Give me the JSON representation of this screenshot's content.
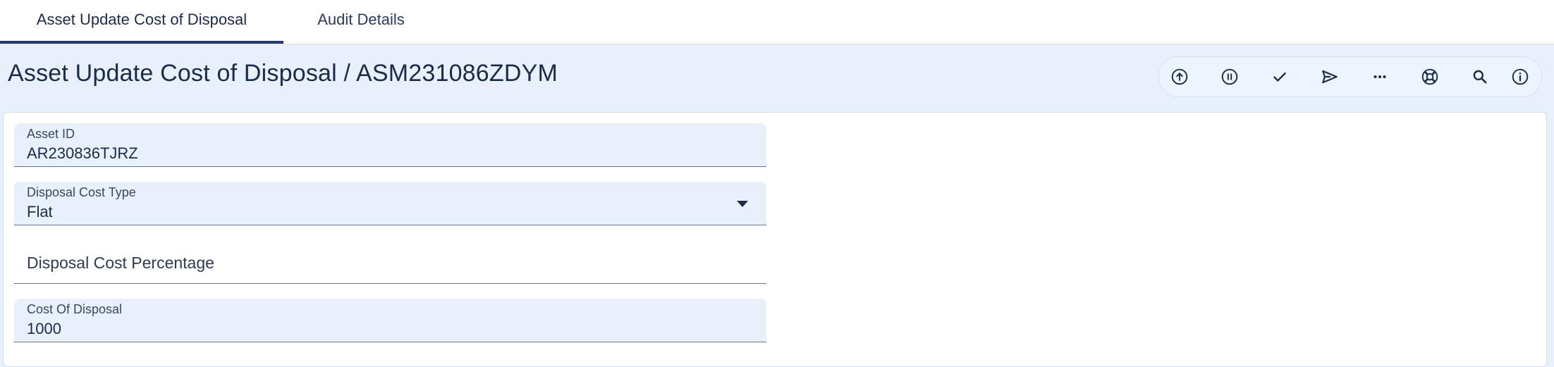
{
  "tabs": [
    {
      "label": "Asset Update Cost of Disposal",
      "active": true
    },
    {
      "label": "Audit Details",
      "active": false
    }
  ],
  "header": {
    "title": "Asset Update Cost of Disposal / ASM231086ZDYM"
  },
  "toolbar": {
    "icons": [
      "upload-icon",
      "pause-icon",
      "check-icon",
      "send-icon",
      "more-icon",
      "lifebuoy-icon",
      "search-icon",
      "info-icon"
    ]
  },
  "form": {
    "asset_id": {
      "label": "Asset ID",
      "value": "AR230836TJRZ"
    },
    "disposal_cost_type": {
      "label": "Disposal Cost Type",
      "value": "Flat"
    },
    "disposal_cost_percentage": {
      "label": "Disposal Cost Percentage",
      "value": ""
    },
    "cost_of_disposal": {
      "label": "Cost Of Disposal",
      "value": "1000"
    }
  },
  "colors": {
    "accent": "#243a6b",
    "field_fill": "#e8f0fb",
    "page_bg": "#e8f0fb"
  }
}
